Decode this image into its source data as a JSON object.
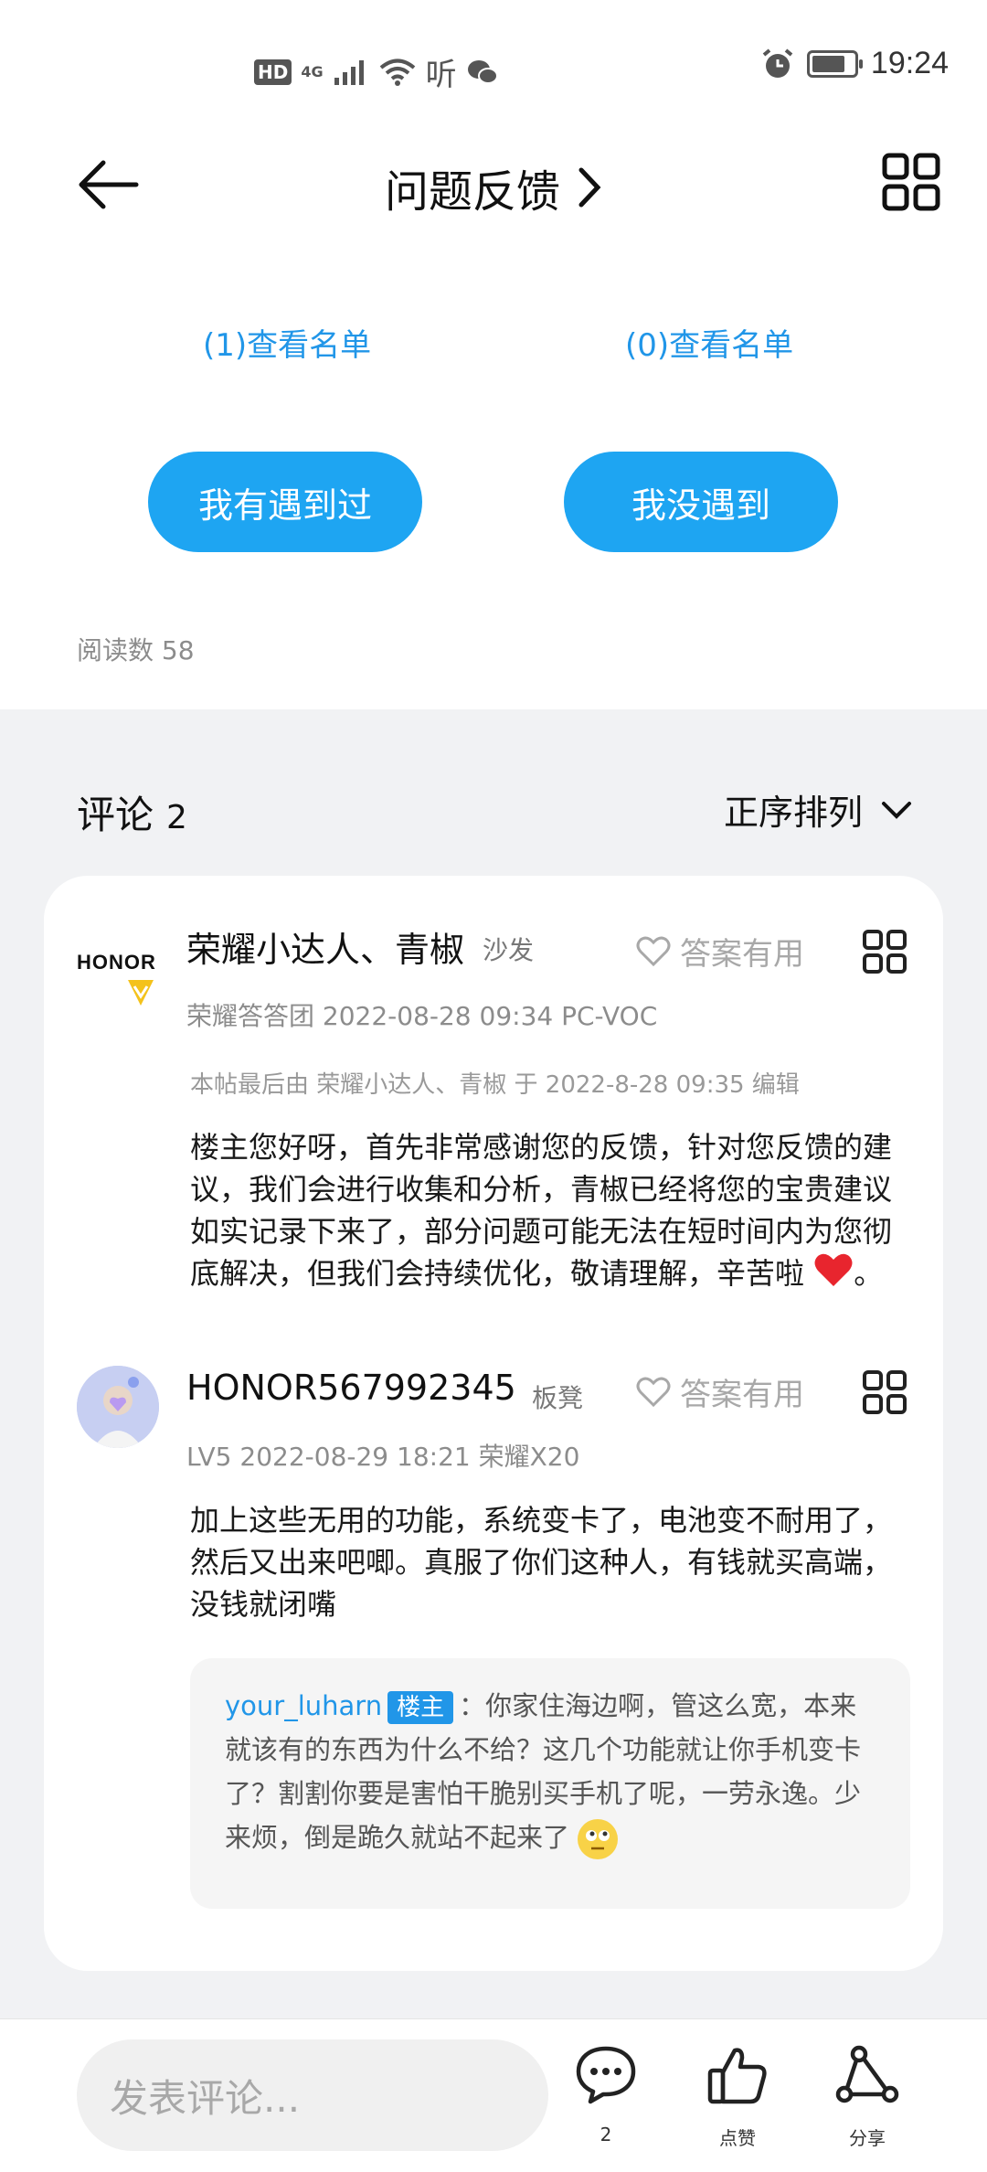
{
  "status_bar": {
    "hd": "HD",
    "network": "4G",
    "listen_icon_text": "听",
    "time": "19:24",
    "battery_level": 0.8
  },
  "header": {
    "title": "问题反馈"
  },
  "vote": {
    "met_list_link": "(1)查看名单",
    "not_met_list_link": "(0)查看名单",
    "met_button": "我有遇到过",
    "not_met_button": "我没遇到"
  },
  "read_count": "阅读数 58",
  "comments": {
    "heading": "评论",
    "count": "2",
    "sort_label": "正序排列",
    "items": [
      {
        "logo_text": "HONOR",
        "name": "荣耀小达人、青椒",
        "floor": "沙发",
        "useful_label": "答案有用",
        "meta": "荣耀答答团   2022-08-28 09:34   PC-VOC",
        "edit_note": "本帖最后由 荣耀小达人、青椒 于 2022-8-28 09:35 编辑",
        "body": "楼主您好呀，首先非常感谢您的反馈，针对您反馈的建议，我们会进行收集和分析，青椒已经将您的宝贵建议如实记录下来了，部分问题可能无法在短时间内为您彻底解决，但我们会持续优化，敬请理解，辛苦啦",
        "body_end": "。"
      },
      {
        "name": "HONOR567992345",
        "floor": "板凳",
        "useful_label": "答案有用",
        "meta": "LV5   2022-08-29 18:21   荣耀X20",
        "body": "加上这些无用的功能，系统变卡了，电池变不耐用了，然后又出来吧唧。真服了你们这种人，有钱就买高端，没钱就闭嘴",
        "reply": {
          "user": "your_luharn",
          "badge": "楼主",
          "text": "：你家住海边啊，管这么宽，本来就该有的东西为什么不给？这几个功能就让你手机变卡了？割割你要是害怕干脆别买手机了呢，一劳永逸。少来烦，倒是跪久就站不起来了"
        }
      }
    ]
  },
  "bottom_bar": {
    "input_placeholder": "发表评论...",
    "comment_count": "2",
    "like_label": "点赞",
    "share_label": "分享"
  },
  "colors": {
    "accent": "#1ea5f2",
    "link": "#2196e8",
    "background_grey": "#f1f2f4",
    "heart": "#e8252e"
  }
}
